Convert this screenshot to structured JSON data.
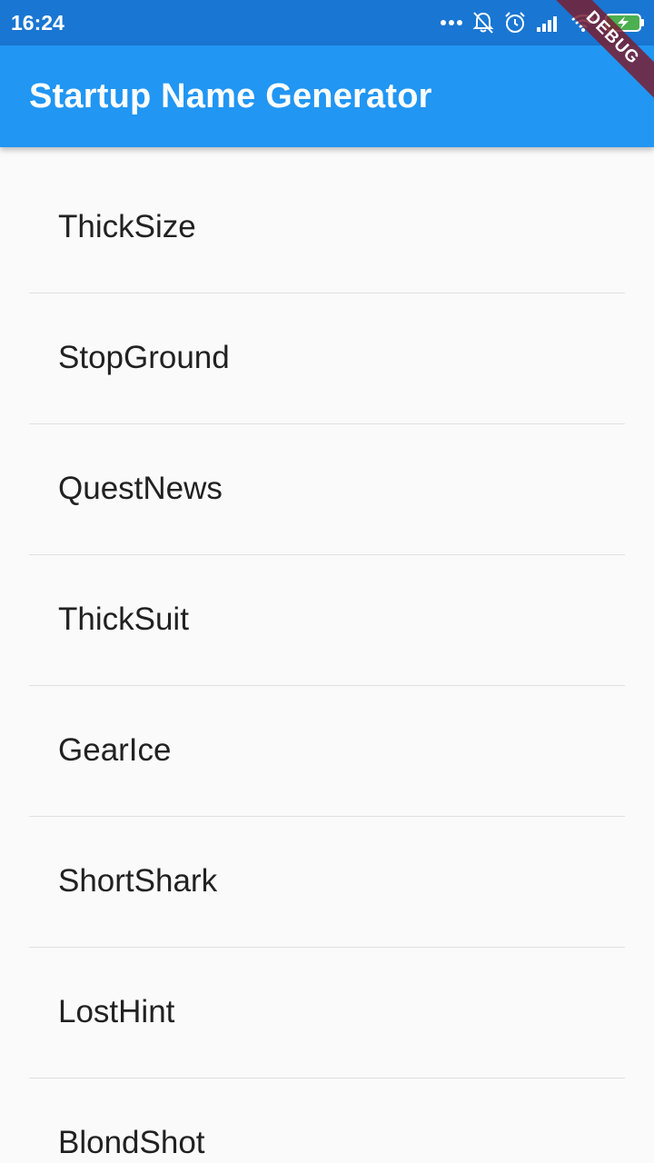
{
  "status_bar": {
    "time": "16:24",
    "icons": [
      "more-dots-icon",
      "notifications-off-icon",
      "alarm-icon",
      "signal-icon",
      "wifi-icon",
      "battery-charging-icon"
    ]
  },
  "app_bar": {
    "title": "Startup Name Generator"
  },
  "debug_banner": {
    "label": "DEBUG"
  },
  "list": {
    "items": [
      {
        "label": "ThickSize"
      },
      {
        "label": "StopGround"
      },
      {
        "label": "QuestNews"
      },
      {
        "label": "ThickSuit"
      },
      {
        "label": "GearIce"
      },
      {
        "label": "ShortShark"
      },
      {
        "label": "LostHint"
      },
      {
        "label": "BlondShot"
      }
    ]
  },
  "colors": {
    "status_bar": "#1976d2",
    "app_bar": "#2196f3",
    "background": "#fafafa",
    "text": "#212121",
    "divider": "#e0e0e0"
  }
}
